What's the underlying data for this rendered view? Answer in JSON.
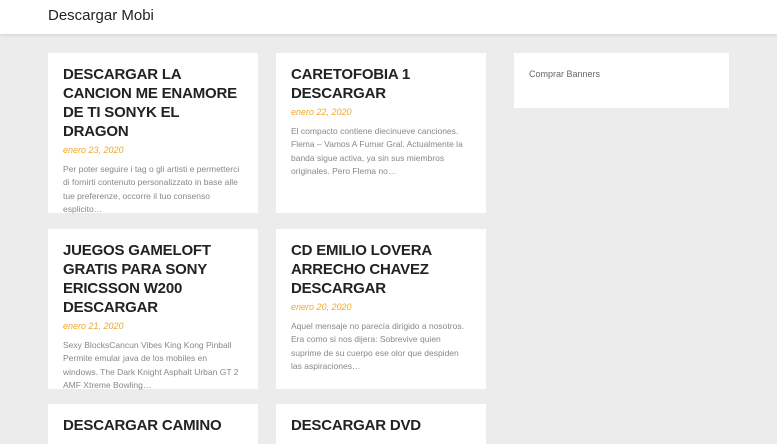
{
  "site": {
    "title": "Descargar Mobi"
  },
  "posts": [
    {
      "title": "DESCARGAR LA CANCION ME ENAMORE DE TI SONYK EL DRAGON",
      "date": "enero 23, 2020",
      "excerpt": "Per poter seguire i tag o gli artisti e permetterci di fornirti contenuto personalizzato in base alle tue preferenze, occorre il tuo consenso esplicito…"
    },
    {
      "title": "CARETOFOBIA 1 DESCARGAR",
      "date": "enero 22, 2020",
      "excerpt": "El compacto contiene diecinueve canciones. Flema – Vamos A Fumar Gral. Actualmente la banda sigue activa, ya sin sus miembros originales. Pero Flema no…"
    },
    {
      "title": "JUEGOS GAMELOFT GRATIS PARA SONY ERICSSON W200 DESCARGAR",
      "date": "enero 21, 2020",
      "excerpt": "Sexy BlocksCancun Vibes King Kong Pinball Permite emular java de los mobiles en windows. The Dark Knight Asphalt Urban GT 2 AMF Xtreme Bowling…"
    },
    {
      "title": "CD EMILIO LOVERA ARRECHO CHAVEZ DESCARGAR",
      "date": "enero 20, 2020",
      "excerpt": "Aquel mensaje no parecía dirigido a nosotros. Era como si nos dijera: Sobrevive quien suprime de su cuerpo ese olor que despiden las aspiraciones…"
    },
    {
      "title": "DESCARGAR CAMINO",
      "date": "",
      "excerpt": ""
    },
    {
      "title": "DESCARGAR DVD",
      "date": "",
      "excerpt": ""
    }
  ],
  "sidebar": {
    "link": "Comprar Banners"
  }
}
